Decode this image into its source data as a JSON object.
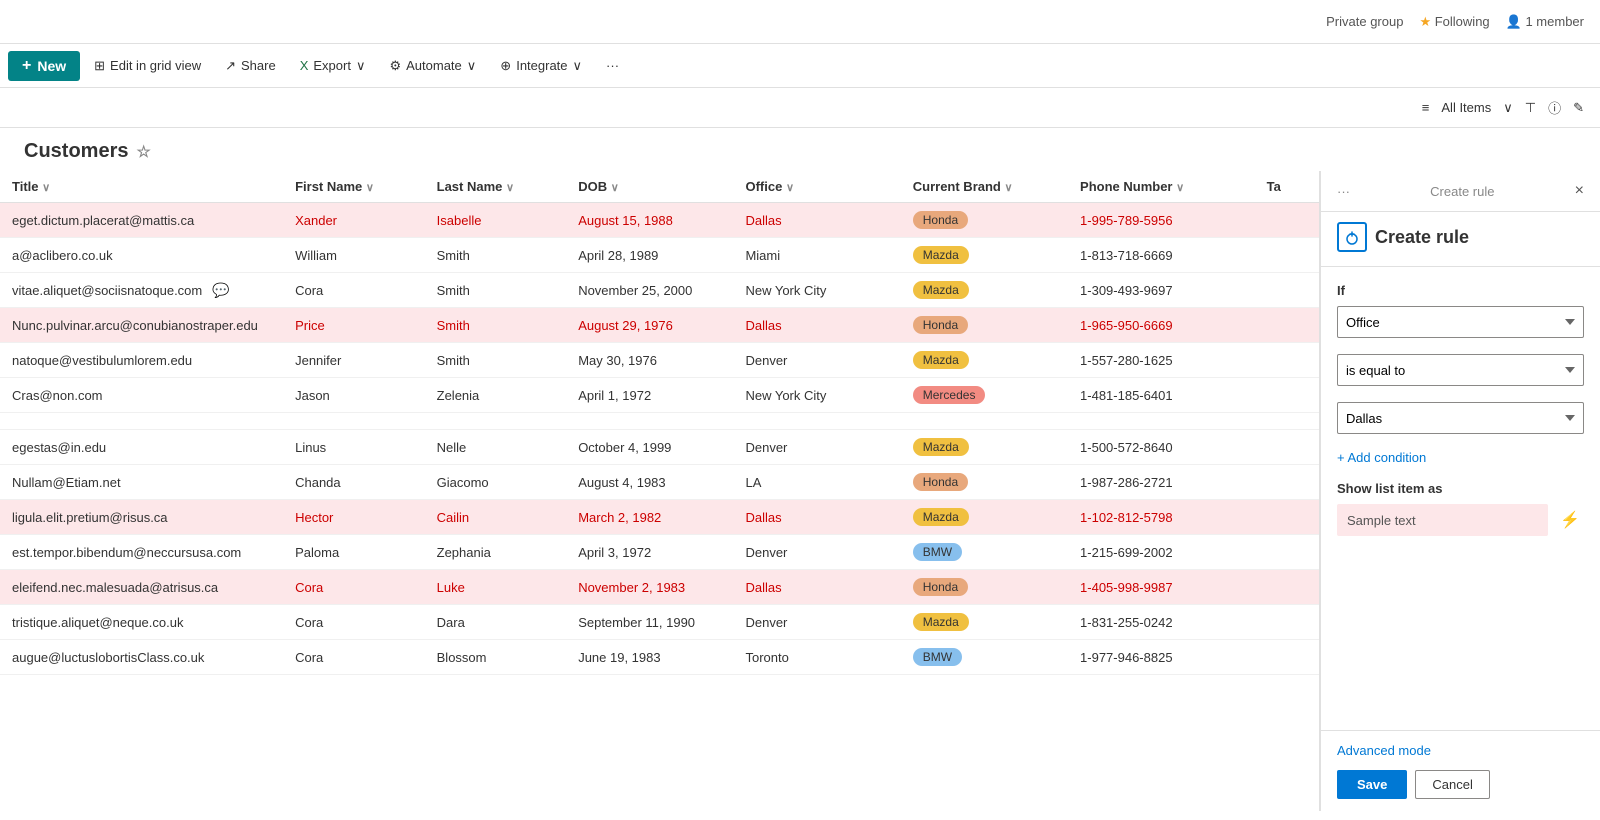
{
  "topbar": {
    "private_group": "Private group",
    "following": "Following",
    "members": "1 member"
  },
  "toolbar": {
    "new_label": "New",
    "edit_grid": "Edit in grid view",
    "share": "Share",
    "export": "Export",
    "automate": "Automate",
    "integrate": "Integrate",
    "more": "···"
  },
  "viewbar": {
    "all_items": "All Items",
    "filter_icon": "⊤",
    "info_icon": "ⓘ",
    "edit_icon": "✎"
  },
  "page": {
    "title": "Customers",
    "fav_star": "☆"
  },
  "table": {
    "columns": [
      {
        "label": "Title",
        "key": "title"
      },
      {
        "label": "First Name",
        "key": "first_name"
      },
      {
        "label": "Last Name",
        "key": "last_name"
      },
      {
        "label": "DOB",
        "key": "dob"
      },
      {
        "label": "Office",
        "key": "office"
      },
      {
        "label": "Current Brand",
        "key": "brand"
      },
      {
        "label": "Phone Number",
        "key": "phone"
      },
      {
        "label": "Ta",
        "key": "ta"
      }
    ],
    "rows": [
      {
        "title": "eget.dictum.placerat@mattis.ca",
        "first_name": "Xander",
        "last_name": "Isabelle",
        "dob": "August 15, 1988",
        "office": "Dallas",
        "brand": "Honda",
        "brand_type": "honda",
        "phone": "1-995-789-5956",
        "highlight": "red",
        "first_red": true,
        "last_red": true,
        "dob_red": true,
        "office_red": true,
        "phone_red": true
      },
      {
        "title": "a@aclibero.co.uk",
        "first_name": "William",
        "last_name": "Smith",
        "dob": "April 28, 1989",
        "office": "Miami",
        "brand": "Mazda",
        "brand_type": "mazda",
        "phone": "1-813-718-6669",
        "highlight": "none"
      },
      {
        "title": "vitae.aliquet@sociisnatoque.com",
        "first_name": "Cora",
        "last_name": "Smith",
        "dob": "November 25, 2000",
        "office": "New York City",
        "brand": "Mazda",
        "brand_type": "mazda",
        "phone": "1-309-493-9697",
        "highlight": "none",
        "has_chat": true
      },
      {
        "title": "Nunc.pulvinar.arcu@conubianostraper.edu",
        "first_name": "Price",
        "last_name": "Smith",
        "dob": "August 29, 1976",
        "office": "Dallas",
        "brand": "Honda",
        "brand_type": "honda",
        "phone": "1-965-950-6669",
        "highlight": "red",
        "first_red": true,
        "last_red": true,
        "dob_red": true,
        "office_red": true,
        "phone_red": true
      },
      {
        "title": "natoque@vestibulumlorem.edu",
        "first_name": "Jennifer",
        "last_name": "Smith",
        "dob": "May 30, 1976",
        "office": "Denver",
        "brand": "Mazda",
        "brand_type": "mazda",
        "phone": "1-557-280-1625",
        "highlight": "none"
      },
      {
        "title": "Cras@non.com",
        "first_name": "Jason",
        "last_name": "Zelenia",
        "dob": "April 1, 1972",
        "office": "New York City",
        "brand": "Mercedes",
        "brand_type": "mercedes",
        "phone": "1-481-185-6401",
        "highlight": "none"
      },
      {
        "title": "",
        "first_name": "",
        "last_name": "",
        "dob": "",
        "office": "",
        "brand": "",
        "brand_type": "",
        "phone": "",
        "highlight": "none"
      },
      {
        "title": "egestas@in.edu",
        "first_name": "Linus",
        "last_name": "Nelle",
        "dob": "October 4, 1999",
        "office": "Denver",
        "brand": "Mazda",
        "brand_type": "mazda",
        "phone": "1-500-572-8640",
        "highlight": "none"
      },
      {
        "title": "Nullam@Etiam.net",
        "first_name": "Chanda",
        "last_name": "Giacomo",
        "dob": "August 4, 1983",
        "office": "LA",
        "brand": "Honda",
        "brand_type": "honda",
        "phone": "1-987-286-2721",
        "highlight": "none"
      },
      {
        "title": "ligula.elit.pretium@risus.ca",
        "first_name": "Hector",
        "last_name": "Cailin",
        "dob": "March 2, 1982",
        "office": "Dallas",
        "brand": "Mazda",
        "brand_type": "mazda",
        "phone": "1-102-812-5798",
        "highlight": "red",
        "first_red": true,
        "last_red": true,
        "dob_red": true,
        "office_red": true,
        "phone_red": true
      },
      {
        "title": "est.tempor.bibendum@neccursusa.com",
        "first_name": "Paloma",
        "last_name": "Zephania",
        "dob": "April 3, 1972",
        "office": "Denver",
        "brand": "BMW",
        "brand_type": "bmw",
        "phone": "1-215-699-2002",
        "highlight": "none"
      },
      {
        "title": "eleifend.nec.malesuada@atrisus.ca",
        "first_name": "Cora",
        "last_name": "Luke",
        "dob": "November 2, 1983",
        "office": "Dallas",
        "brand": "Honda",
        "brand_type": "honda",
        "phone": "1-405-998-9987",
        "highlight": "red",
        "first_red": true,
        "last_red": true,
        "dob_red": true,
        "office_red": true,
        "phone_red": true
      },
      {
        "title": "tristique.aliquet@neque.co.uk",
        "first_name": "Cora",
        "last_name": "Dara",
        "dob": "September 11, 1990",
        "office": "Denver",
        "brand": "Mazda",
        "brand_type": "mazda",
        "phone": "1-831-255-0242",
        "highlight": "none"
      },
      {
        "title": "augue@luctuslobortisClass.co.uk",
        "first_name": "Cora",
        "last_name": "Blossom",
        "dob": "June 19, 1983",
        "office": "Toronto",
        "brand": "BMW",
        "brand_type": "bmw",
        "phone": "1-977-946-8825",
        "highlight": "none"
      }
    ]
  },
  "rule_panel": {
    "breadcrumb": "···",
    "breadcrumb_label": "Create rule",
    "close_label": "×",
    "title": "Create rule",
    "if_label": "If",
    "condition_field": "Office",
    "condition_operator": "is equal to",
    "condition_value": "Dallas",
    "add_condition": "+ Add condition",
    "show_as_label": "Show list item as",
    "sample_text": "Sample text",
    "format_icon": "⚡",
    "advanced_mode": "Advanced mode",
    "save_label": "Save",
    "cancel_label": "Cancel"
  }
}
